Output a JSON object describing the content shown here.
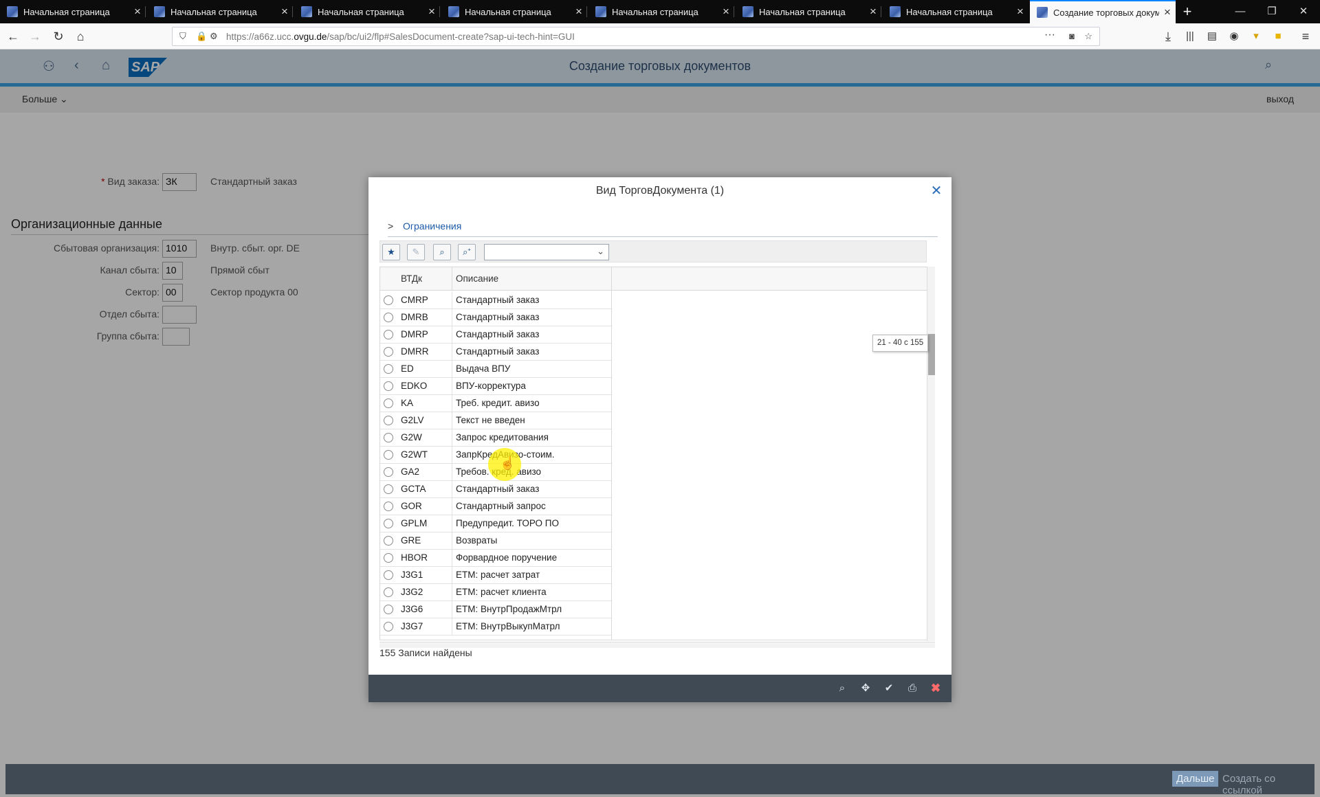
{
  "browser": {
    "tabs": [
      {
        "label": "Начальная страница",
        "active": false
      },
      {
        "label": "Начальная страница",
        "active": false
      },
      {
        "label": "Начальная страница",
        "active": false
      },
      {
        "label": "Начальная страница",
        "active": false
      },
      {
        "label": "Начальная страница",
        "active": false
      },
      {
        "label": "Начальная страница",
        "active": false
      },
      {
        "label": "Начальная страница",
        "active": false
      },
      {
        "label": "Создание торговых докуме",
        "active": true
      }
    ],
    "url_prefix": "https://a66z.ucc.",
    "url_domain": "ovgu.de",
    "url_rest": "/sap/bc/ui2/flp#SalesDocument-create?sap-ui-tech-hint=GUI"
  },
  "shell": {
    "title": "Создание торговых документов",
    "logo": "SAP",
    "more_label": "Больше",
    "exit_label": "выход"
  },
  "form": {
    "order_type_label": "Вид заказа:",
    "order_type_value": "ЗК",
    "order_type_text": "Стандартный заказ",
    "section_title": "Организационные данные",
    "sales_org_label": "Сбытовая организация:",
    "sales_org_value": "1010",
    "sales_org_text": "Внутр. сбыт. орг. DE",
    "channel_label": "Канал сбыта:",
    "channel_value": "10",
    "channel_text": "Прямой сбыт",
    "sector_label": "Сектор:",
    "sector_value": "00",
    "sector_text": "Сектор продукта 00",
    "office_label": "Отдел сбыта:",
    "group_label": "Группа сбыта:"
  },
  "dialog": {
    "title": "Вид ТорговДокумента (1)",
    "restrictions_label": "Ограничения",
    "col_code": "ВТДк",
    "col_desc": "Описание",
    "scroll_tooltip": "21 - 40 с 155",
    "found_text": "155 Записи найдены",
    "rows": [
      {
        "code": "CMRP",
        "desc": "Стандартный заказ"
      },
      {
        "code": "DMRB",
        "desc": "Стандартный заказ"
      },
      {
        "code": "DMRP",
        "desc": "Стандартный заказ"
      },
      {
        "code": "DMRR",
        "desc": "Стандартный заказ"
      },
      {
        "code": "ED",
        "desc": "Выдача ВПУ"
      },
      {
        "code": "EDKO",
        "desc": "ВПУ-корректура"
      },
      {
        "code": "KA",
        "desc": "Треб. кредит. авизо"
      },
      {
        "code": "G2LV",
        "desc": "Текст не введен"
      },
      {
        "code": "G2W",
        "desc": "Запрос кредитования"
      },
      {
        "code": "G2WT",
        "desc": "ЗапрКредАвизо-стоим."
      },
      {
        "code": "GA2",
        "desc": "Требов. кред. авизо"
      },
      {
        "code": "GCTA",
        "desc": "Стандартный заказ"
      },
      {
        "code": "GOR",
        "desc": "Стандартный запрос"
      },
      {
        "code": "GPLM",
        "desc": "Предупредит. ТОРО ПО"
      },
      {
        "code": "GRE",
        "desc": "Возвраты"
      },
      {
        "code": "HBOR",
        "desc": "Форвардное поручение"
      },
      {
        "code": "J3G1",
        "desc": "ETM: расчет затрат"
      },
      {
        "code": "J3G2",
        "desc": "ETM: расчет клиента"
      },
      {
        "code": "J3G6",
        "desc": "ETM: ВнутрПродажМтрл"
      },
      {
        "code": "J3G7",
        "desc": "ETM: ВнутрВыкупМатрл"
      }
    ]
  },
  "footer": {
    "continue_label": "Дальше",
    "create_ref_label": "Создать со ссылкой"
  },
  "colors": {
    "shell_bg": "#dce8f3",
    "shell_accent": "#3aa3e3",
    "footer_bg": "#3f4a55",
    "link": "#1a5aa8",
    "cancel": "#ff6a6a"
  }
}
